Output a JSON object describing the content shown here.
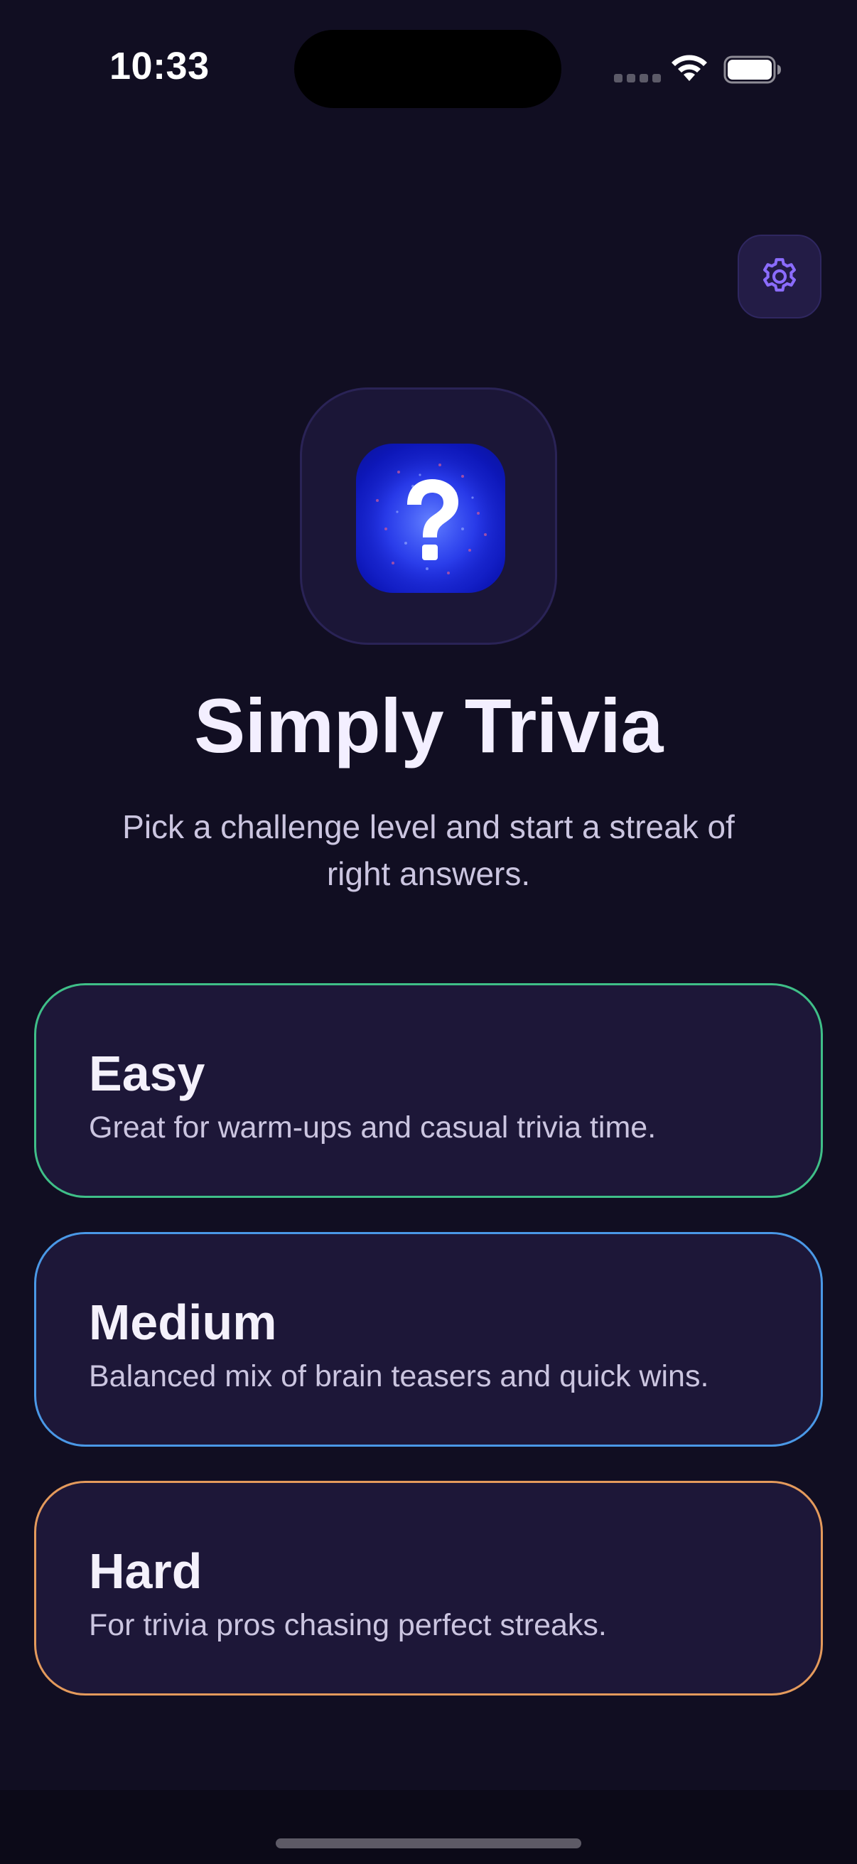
{
  "status_bar": {
    "time": "10:33"
  },
  "icons": {
    "settings": "gear-icon",
    "wifi": "wifi-icon",
    "battery": "battery-icon",
    "logo": "question-mark-icon"
  },
  "header": {
    "title": "Simply Trivia",
    "subtitle": "Pick a challenge level and start a streak of right answers."
  },
  "difficulties": [
    {
      "label": "Easy",
      "description": "Great for warm-ups and casual trivia time.",
      "accent": "#3fbf88"
    },
    {
      "label": "Medium",
      "description": "Balanced mix of brain teasers and quick wins.",
      "accent": "#4a98e6"
    },
    {
      "label": "Hard",
      "description": "For trivia pros chasing perfect streaks.",
      "accent": "#e49a5c"
    }
  ],
  "colors": {
    "background": "#110e22",
    "card_background": "#1d1738",
    "settings_accent": "#8b6cff"
  }
}
